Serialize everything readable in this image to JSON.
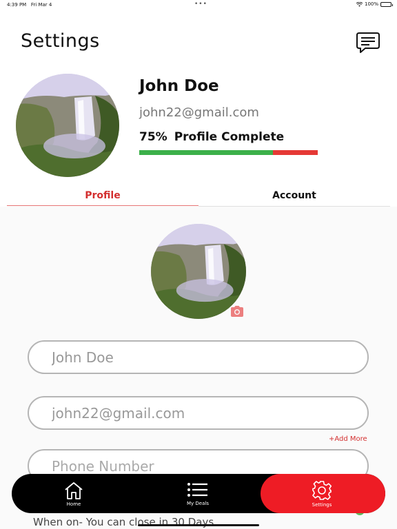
{
  "status_bar": {
    "time": "4:39 PM",
    "date": "Fri Mar 4",
    "battery": "100%"
  },
  "header": {
    "title": "Settings"
  },
  "user": {
    "name": "John Doe",
    "email": "john22@gmail.com",
    "profile_percent_label": "75%",
    "profile_complete_label": "Profile Complete",
    "profile_complete_fraction": 0.75
  },
  "tabs": {
    "profile": "Profile",
    "account": "Account"
  },
  "form": {
    "name_value": "John Doe",
    "email_value": "john22@gmail.com",
    "phone_placeholder": "Phone Number",
    "add_more": "+Add More",
    "toggle_text": "When on- You can close in 30 Days"
  },
  "tabbar": {
    "home": "Home",
    "deals": "My Deals",
    "settings": "Settings"
  },
  "colors": {
    "accent": "#ee1c25",
    "progress_done": "#3cb04a",
    "progress_remaining": "#e53935",
    "tab_active": "#d32f2f"
  },
  "icons": [
    "chat-icon",
    "camera-icon",
    "home-icon",
    "list-icon",
    "gear-icon",
    "wifi-icon",
    "battery-icon"
  ]
}
